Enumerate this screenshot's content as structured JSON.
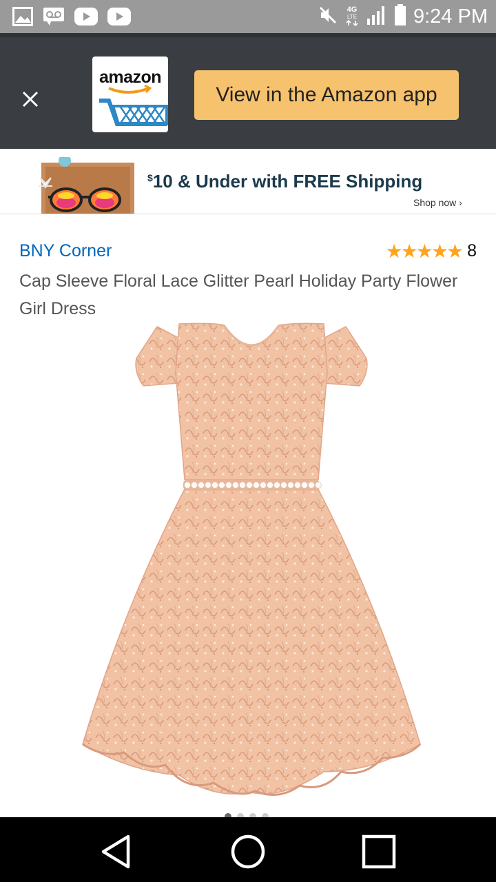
{
  "status_bar": {
    "time": "9:24 PM",
    "network": "4G LTE",
    "icons": [
      "image-icon",
      "voicemail-icon",
      "youtube-icon",
      "youtube-icon",
      "mute-icon",
      "signal-icon",
      "battery-icon"
    ]
  },
  "app_banner": {
    "logo_text": "amazon",
    "cta_label": "View in the Amazon app",
    "cta_color": "#f7c26d",
    "bg_color": "#3a3d42"
  },
  "ad": {
    "currency": "$",
    "headline": "10 & Under with FREE Shipping",
    "cta": "Shop now ›"
  },
  "product": {
    "brand": "BNY Corner",
    "rating_stars": "★★★★★",
    "rating_value": 5,
    "rating_count": "8",
    "title": "Cap Sleeve Floral Lace Glitter Pearl Holiday Party Flower Girl Dress",
    "image_count": 4,
    "current_image": 1
  },
  "nav": {
    "buttons": [
      "back-icon",
      "home-icon",
      "recents-icon"
    ]
  }
}
